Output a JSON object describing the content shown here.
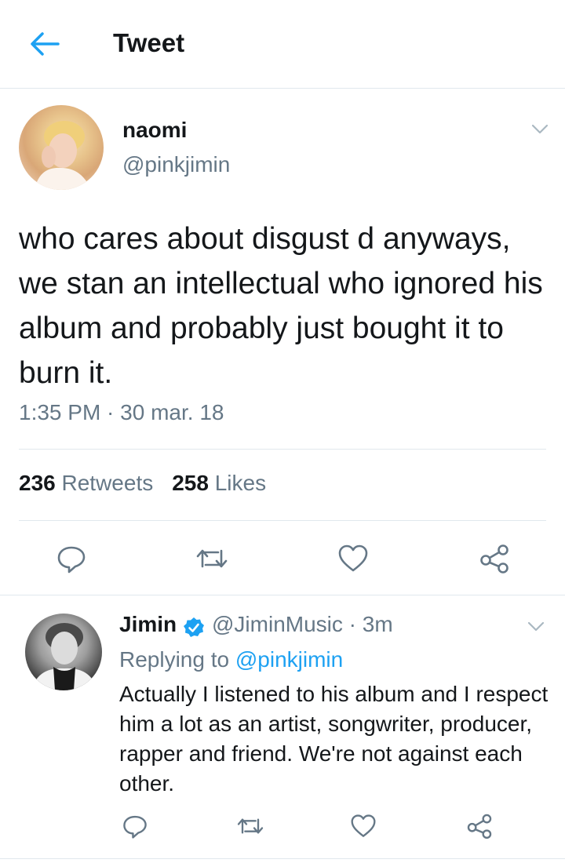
{
  "header": {
    "title": "Tweet",
    "back_icon": "back-arrow-icon"
  },
  "colors": {
    "accent": "#1da1f2",
    "text": "#14171a",
    "secondary": "#657786",
    "divider": "#e1e8ed"
  },
  "main_tweet": {
    "display_name": "naomi",
    "handle": "@pinkjimin",
    "text": "who cares about disgust d anyways, we stan an intellectual who ignored his album and probably just bought it to burn it.",
    "timestamp": "1:35 PM · 30 mar. 18",
    "retweet_count": "236",
    "retweet_label": "Retweets",
    "like_count": "258",
    "like_label": "Likes"
  },
  "reply_tweet": {
    "display_name": "Jimin",
    "handle_time": "@JiminMusic · 3m",
    "replying_prefix": "Replying to",
    "replying_handle": "@pinkjimin",
    "text": "Actually I listened to his album and I respect him a lot as an artist, songwriter, producer, rapper and friend. We're not against each other."
  }
}
